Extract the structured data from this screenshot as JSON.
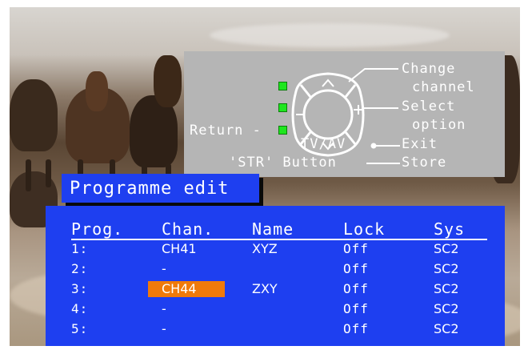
{
  "help": {
    "change": "Change",
    "channel": "channel",
    "select": "Select",
    "option": "option",
    "return_label": "Return -",
    "tvav": "TV/AV",
    "exit": "Exit",
    "str_button": "'STR' Button",
    "store": "Store"
  },
  "menu": {
    "title": "Programme edit",
    "columns": [
      "Prog.",
      "Chan.",
      "Name",
      "Lock",
      "Sys"
    ],
    "rows": [
      {
        "prog": "1:",
        "chan": "CH41",
        "name": "XYZ",
        "lock": "Off",
        "sys": "SC2",
        "selected": false
      },
      {
        "prog": "2:",
        "chan": "-",
        "name": "",
        "lock": "Off",
        "sys": "SC2",
        "selected": false
      },
      {
        "prog": "3:",
        "chan": "CH44",
        "name": "ZXY",
        "lock": "Off",
        "sys": "SC2",
        "selected": true
      },
      {
        "prog": "4:",
        "chan": "-",
        "name": "",
        "lock": "Off",
        "sys": "SC2",
        "selected": false
      },
      {
        "prog": "5:",
        "chan": "-",
        "name": "",
        "lock": "Off",
        "sys": "SC2",
        "selected": false
      }
    ]
  },
  "colors": {
    "menu_blue": "#1e3ff0",
    "highlight": "#f07a0a",
    "led_green": "#1ee61e",
    "help_panel": "#b5b5b5"
  }
}
